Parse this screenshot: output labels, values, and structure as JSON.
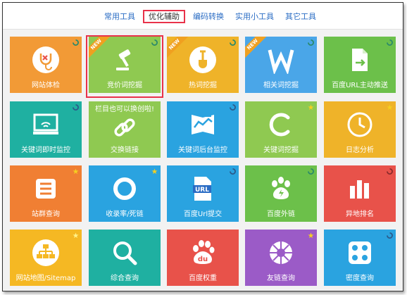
{
  "tabs": [
    {
      "label": "常用工具"
    },
    {
      "label": "优化辅助"
    },
    {
      "label": "编码转换"
    },
    {
      "label": "实用小工具"
    },
    {
      "label": "其它工具"
    }
  ],
  "tiles": [
    {
      "label": "网站体检",
      "color": "#f29a36",
      "icon": "stethoscope-shield-icon"
    },
    {
      "label": "竞价词挖掘",
      "color": "#8fc951",
      "icon": "gavel-icon",
      "badge": "NEW"
    },
    {
      "label": "热词挖掘",
      "color": "#efb329",
      "icon": "shovel-icon",
      "badge": "NEW"
    },
    {
      "label": "相关词挖掘",
      "color": "#4aa6e8",
      "icon": "w-letter-icon",
      "badge": "NEW"
    },
    {
      "label": "百度URL主动推送",
      "color": "#6cc04a",
      "icon": "file-export-icon"
    },
    {
      "label": "关键词即时监控",
      "color": "#1fb0a1",
      "icon": "monitor-icon"
    },
    {
      "label": "交换链接",
      "color": "#8fc951",
      "icon": "link-icon",
      "note": "栏目也可以换创啦!"
    },
    {
      "label": "关键词后台监控",
      "color": "#2aa3e0",
      "icon": "chart-icon"
    },
    {
      "label": "关键词挖掘",
      "color": "#8fc951",
      "icon": "c-letter-icon"
    },
    {
      "label": "日志分析",
      "color": "#efb329",
      "icon": "clock-icon"
    },
    {
      "label": "站群查询",
      "color": "#f07f33",
      "icon": "list-icon"
    },
    {
      "label": "收录率/死链",
      "color": "#2aa3e0",
      "icon": "ring-icon"
    },
    {
      "label": "百度Url提交",
      "color": "#2aa3e0",
      "icon": "url-file-icon"
    },
    {
      "label": "百度外链",
      "color": "#6cc04a",
      "icon": "baidu-paw-icon"
    },
    {
      "label": "异地排名",
      "color": "#e8524a",
      "icon": "bars-icon"
    },
    {
      "label": "网站地图/Sitemap",
      "color": "#f5b823",
      "icon": "sitemap-icon"
    },
    {
      "label": "综合查询",
      "color": "#1fb0a1",
      "icon": "magnifier-icon"
    },
    {
      "label": "百度权重",
      "color": "#e8524a",
      "icon": "baidu-du-icon"
    },
    {
      "label": "友链查询",
      "color": "#9b5bc7",
      "icon": "aperture-icon"
    },
    {
      "label": "密度查询",
      "color": "#2aa3e0",
      "icon": "dice-icon"
    }
  ],
  "icon_text": {
    "url": "URL",
    "new": "NEW",
    "du": "du"
  }
}
